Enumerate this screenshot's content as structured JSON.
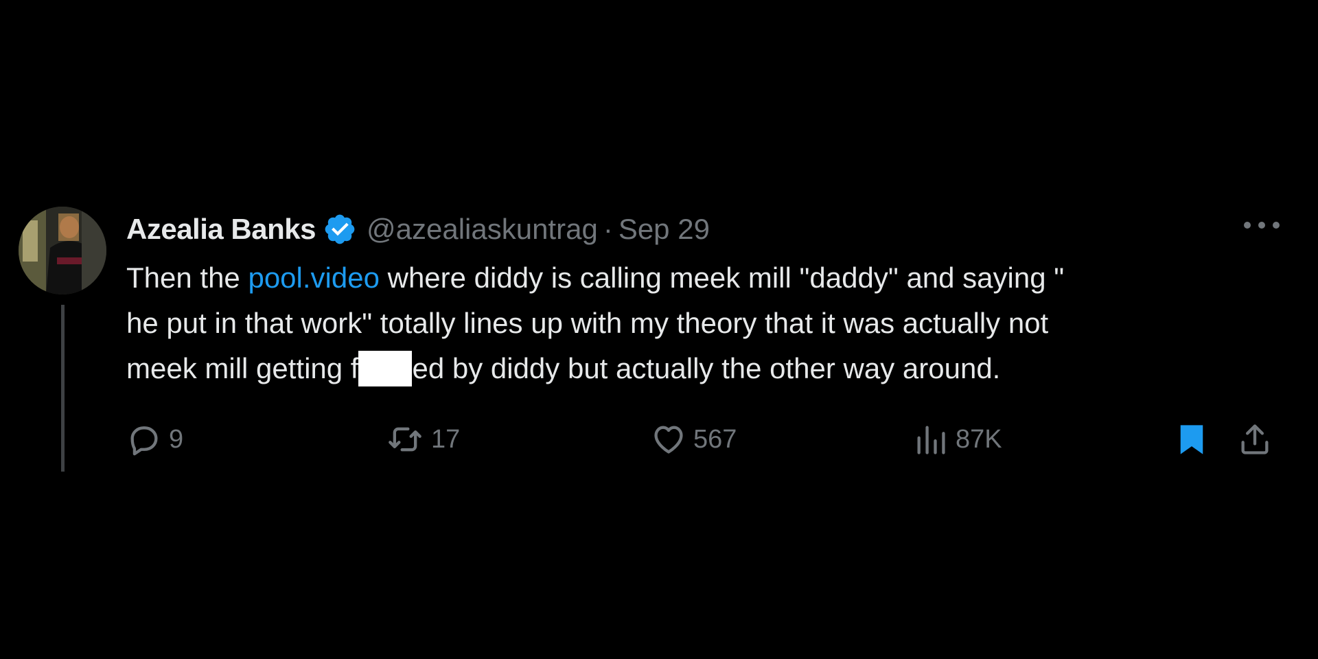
{
  "tweet": {
    "display_name": "Azealia Banks",
    "handle": "@azealiaskuntrag",
    "separator": "·",
    "date": "Sep 29",
    "verified": true,
    "text": {
      "line1_pre": "Then the ",
      "link": "pool.video",
      "line1_post": " where diddy is calling meek mill \"daddy\" and saying \"",
      "line2": "he put in that work\" totally lines up with my theory that it was actually not",
      "line3_pre": "meek mill getting f",
      "line3_post": "ed by diddy but actually the other way around."
    },
    "stats": {
      "replies": "9",
      "reposts": "17",
      "likes": "567",
      "views": "87K"
    },
    "bookmarked": true
  },
  "icons": {
    "reply": "reply-icon",
    "repost": "repost-icon",
    "like": "heart-icon",
    "views": "views-icon",
    "bookmark": "bookmark-icon",
    "share": "share-icon",
    "more": "more-icon",
    "verified": "verified-badge-icon"
  },
  "colors": {
    "background": "#000000",
    "text": "#e7e9ea",
    "muted": "#71767b",
    "accent": "#1d9bf0"
  }
}
